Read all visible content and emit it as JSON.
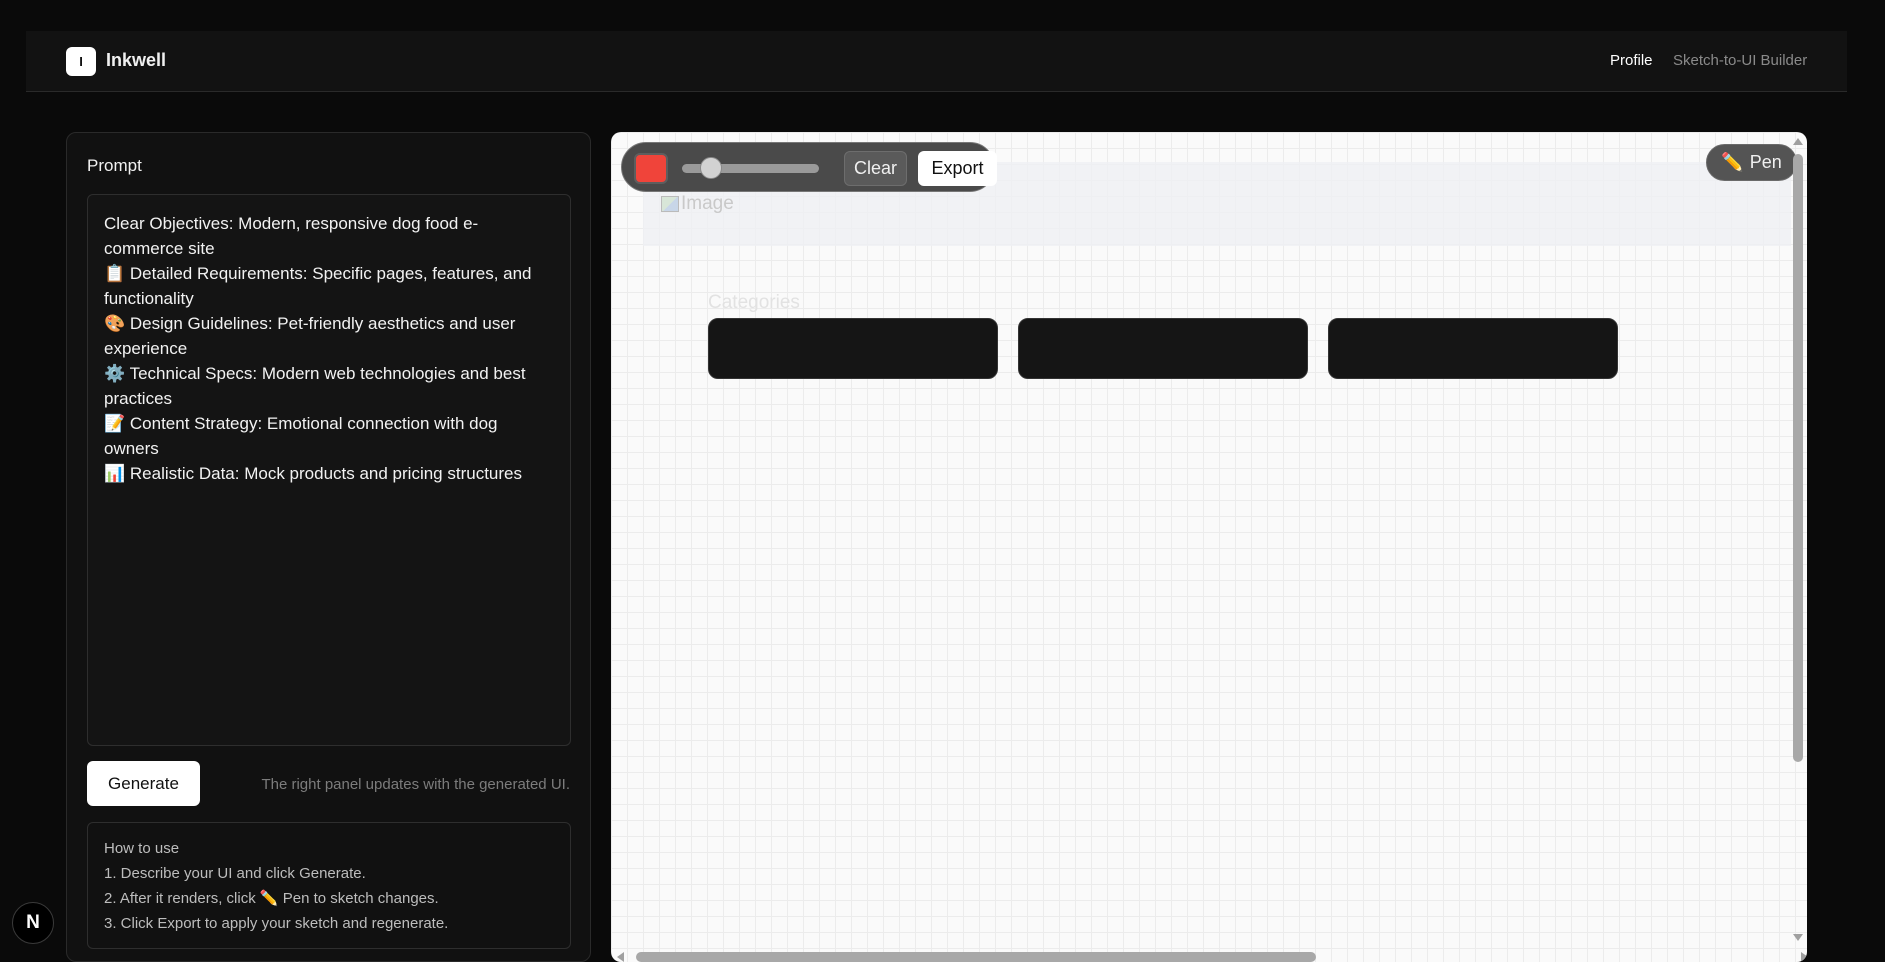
{
  "header": {
    "logo_letter": "I",
    "brand": "Inkwell",
    "nav": {
      "profile": "Profile",
      "builder": "Sketch-to-UI Builder"
    }
  },
  "prompt_panel": {
    "title": "Prompt",
    "lines": [
      "Clear Objectives: Modern, responsive dog food e-commerce site",
      "📋 Detailed Requirements: Specific pages, features, and functionality",
      "🎨 Design Guidelines: Pet-friendly aesthetics and user experience",
      "⚙️ Technical Specs: Modern web technologies and best practices",
      "📝 Content Strategy: Emotional connection with dog owners",
      "📊 Realistic Data: Mock products and pricing structures"
    ],
    "generate_label": "Generate",
    "hint": "The right panel updates with the generated UI.",
    "howto": {
      "title": "How to use",
      "steps": [
        "1. Describe your UI and click Generate.",
        "2. After it renders, click ✏️ Pen to sketch changes.",
        "3. Click Export to apply your sketch and regenerate."
      ]
    }
  },
  "canvas": {
    "toolbar": {
      "color": "#f0443a",
      "clear_label": "Clear",
      "export_label": "Export",
      "brush_size_fraction": 0.2
    },
    "pen_label": "Pen",
    "pen_icon": "pencil-icon",
    "preview": {
      "image_alt": "Image",
      "categories_label": "Categories"
    }
  },
  "badge": {
    "letter": "N"
  }
}
